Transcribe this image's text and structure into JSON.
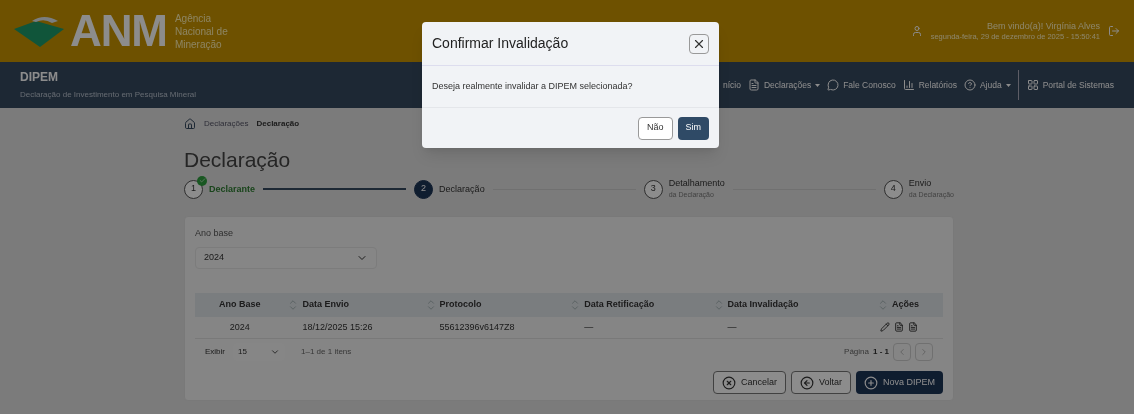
{
  "header": {
    "brand": "ANM",
    "brand_subtitle": "Agência Nacional de Mineração",
    "greeting": "Bem vindo(a)! Virgínia Alves",
    "date": "segunda-feira, 29 de dezembro de 2025 - 15:50:41"
  },
  "navbar": {
    "title": "DIPEM",
    "subtitle": "Declaração de Investimento em Pesquisa Mineral",
    "items": [
      {
        "label": "nício",
        "kind": "link"
      },
      {
        "label": "Declarações",
        "kind": "dropdown"
      },
      {
        "label": "Fale Conosco",
        "kind": "link"
      },
      {
        "label": "Relatórios",
        "kind": "link"
      },
      {
        "label": "Ajuda",
        "kind": "dropdown"
      },
      {
        "label": "Portal de Sistemas",
        "kind": "portal"
      }
    ]
  },
  "breadcrumb": [
    "Declarações",
    "Declaração"
  ],
  "page_title": "Declaração",
  "steps": [
    {
      "number": "1",
      "label": "Declarante",
      "completed": true,
      "selected": false
    },
    {
      "number": "2",
      "label": "Declaração",
      "completed": false,
      "selected": true
    },
    {
      "number": "3",
      "label": "Detalhamento",
      "sublabel": "da Declaração",
      "completed": false,
      "selected": false
    },
    {
      "number": "4",
      "label": "Envio",
      "sublabel": "da Declaração",
      "completed": false,
      "selected": false
    }
  ],
  "ano_base": {
    "label": "Ano base",
    "value": "2024"
  },
  "table": {
    "columns": [
      "Ano Base",
      "Data Envio",
      "Protocolo",
      "Data Retificação",
      "Data Invalidação",
      "Ações"
    ],
    "rows": [
      [
        "2024",
        "18/12/2025 15:26",
        "55612396v6147Z8",
        "—",
        "—"
      ]
    ]
  },
  "pagination": {
    "show_label": "Exibir",
    "page_size": "15",
    "count": "1–1 de 1 itens",
    "page_info": "Página",
    "page_range": "1 - 1"
  },
  "buttons": [
    {
      "label": "Cancelar",
      "kind": "cancel"
    },
    {
      "label": "Voltar",
      "kind": "back"
    },
    {
      "label": "Nova DIPEM",
      "kind": "primary"
    }
  ],
  "modal": {
    "title": "Confirmar Invalidação",
    "message": "Deseja realmente invalidar a DIPEM selecionada?",
    "buttons": [
      {
        "label": "Não",
        "kind": "secondary"
      },
      {
        "label": "Sim",
        "kind": "primary"
      }
    ]
  }
}
